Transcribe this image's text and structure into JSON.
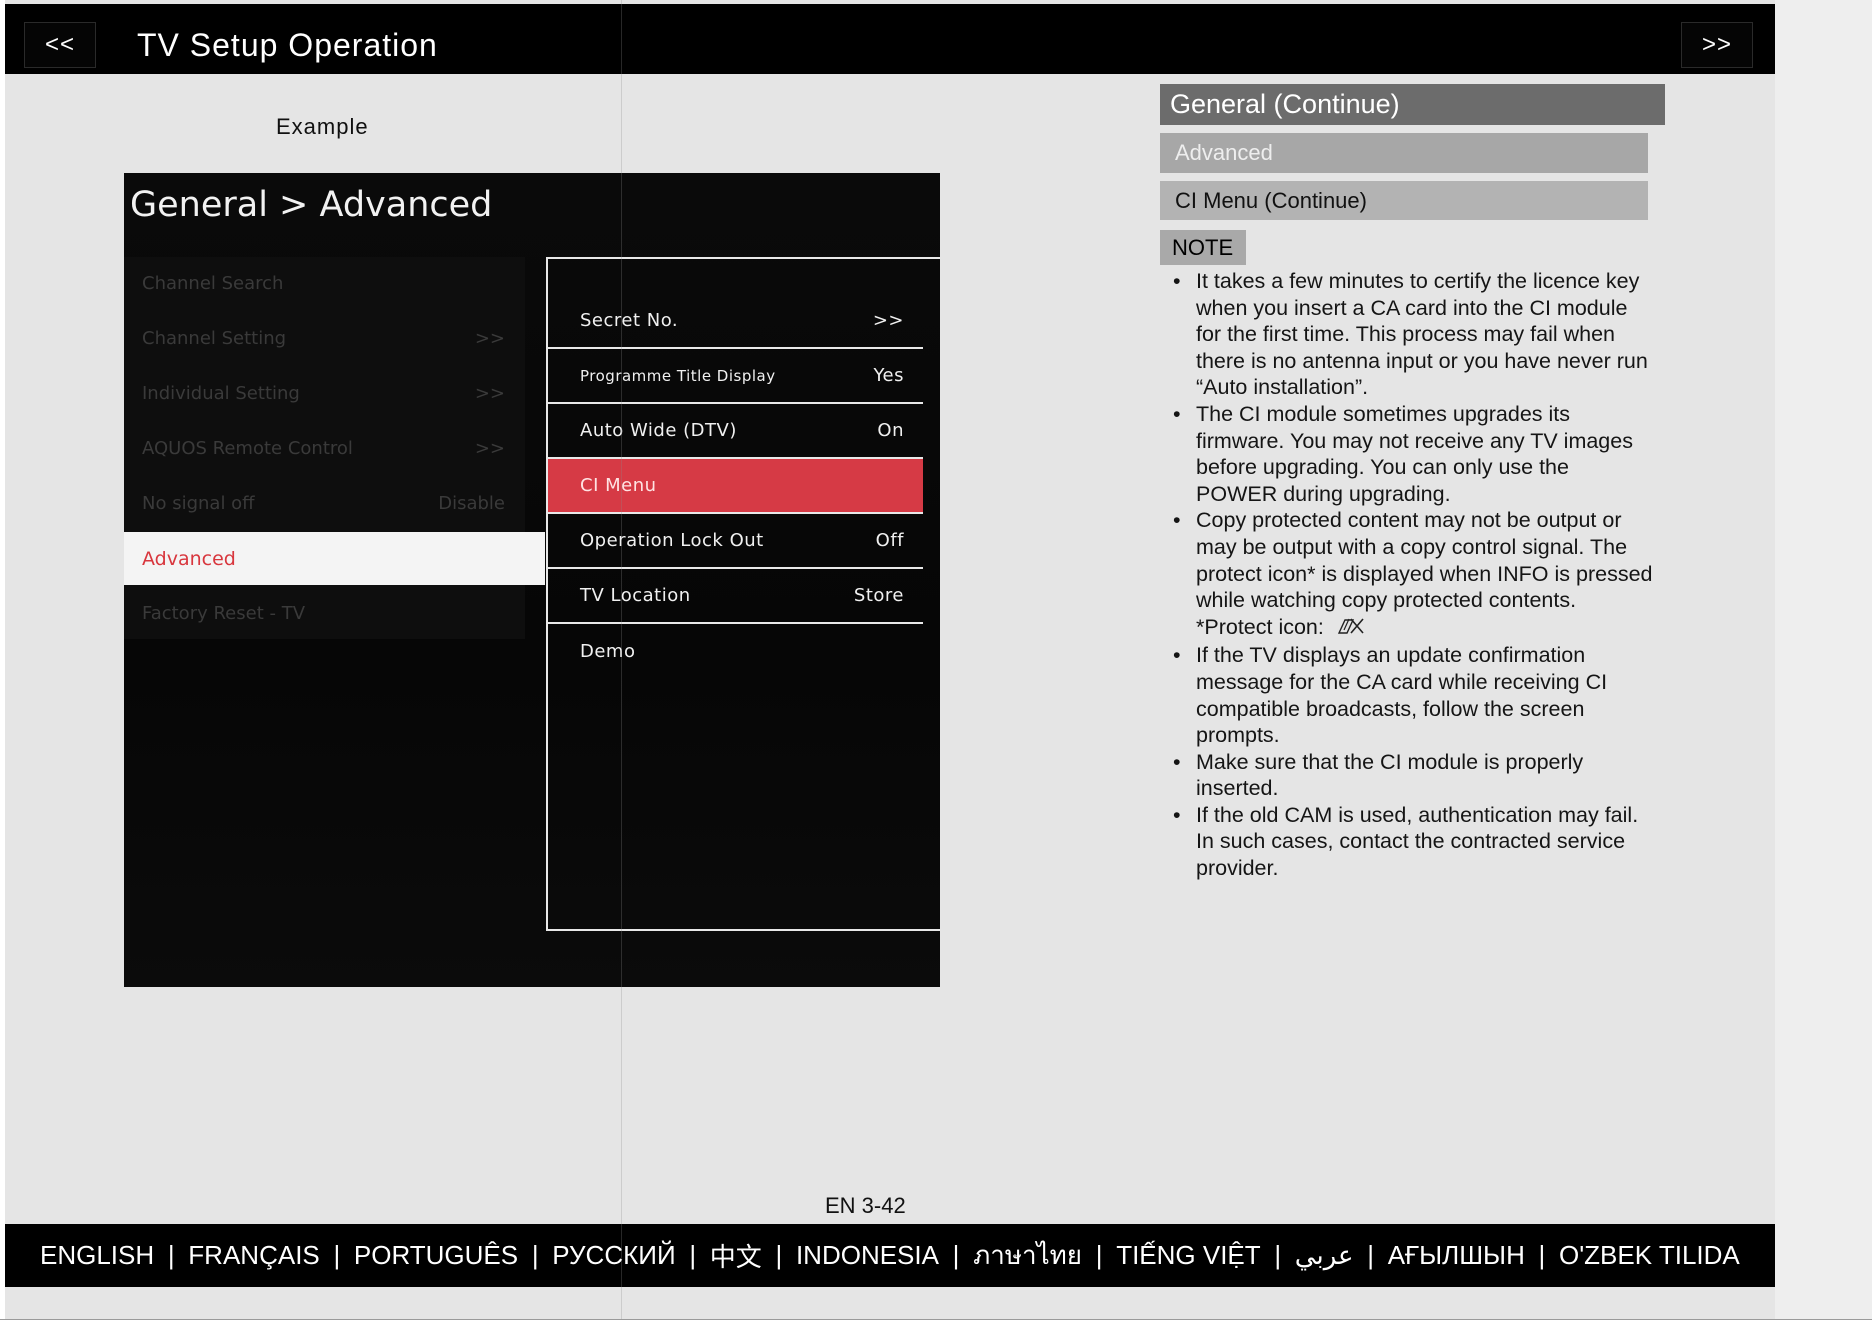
{
  "header": {
    "prev_label": "<<",
    "title": "TV Setup Operation",
    "next_label": ">>"
  },
  "example_label": "Example",
  "tv_screen": {
    "breadcrumb": "General > Advanced",
    "left_menu": [
      {
        "label": "Channel Search",
        "value": ""
      },
      {
        "label": "Channel Setting",
        "value": ">>"
      },
      {
        "label": "Individual Setting",
        "value": ">>"
      },
      {
        "label": "AQUOS Remote Control",
        "value": ">>"
      },
      {
        "label": "No signal off",
        "value": "Disable"
      },
      {
        "label": "Advanced",
        "value": "",
        "selected": true
      },
      {
        "label": "Factory Reset - TV",
        "value": ""
      }
    ],
    "right_menu": [
      {
        "label": "Secret No.",
        "value": ">>"
      },
      {
        "label": "Programme Title Display",
        "value": "Yes"
      },
      {
        "label": "Auto Wide (DTV)",
        "value": "On"
      },
      {
        "label": "CI Menu",
        "value": "",
        "selected": true
      },
      {
        "label": "Operation Lock Out",
        "value": "Off"
      },
      {
        "label": "TV Location",
        "value": "Store"
      },
      {
        "label": "Demo",
        "value": ""
      }
    ]
  },
  "sidebar": {
    "section_title": "General (Continue)",
    "subsection": "Advanced",
    "topic": "CI Menu (Continue)",
    "note_label": "NOTE",
    "bullet": "•",
    "notes": [
      "It takes a few minutes to certify the licence key when you insert a CA card into the CI module for the first time. This process may fail when there is no antenna input or you have never run “Auto installation”.",
      "The CI module sometimes upgrades its firmware. You may not receive any TV images before upgrading. You can only use the POWER during upgrading.",
      "Copy protected content may not be output or may be output with a copy control signal. The protect icon* is displayed when INFO is pressed while watching copy protected contents.",
      "If the TV displays an update confirmation message for the CA card while receiving CI compatible broadcasts, follow the screen prompts.",
      "Make sure that the CI module is properly inserted.",
      "If the old CAM is used, authentication may fail. In such cases, contact the contracted service provider."
    ],
    "protect_icon_label": "*Protect icon:",
    "protect_icon": "copy-protect-icon"
  },
  "page_number": "EN 3-42",
  "language_separator": "|",
  "languages": [
    "ENGLISH",
    "FRANÇAIS",
    "PORTUGUÊS",
    "РУССКИЙ",
    "中文",
    "INDONESIA",
    "ภาษาไทย",
    "TIẾNG VIỆT",
    "عربي",
    "АҒЫЛШЫН",
    "O'ZBEK TILIDA"
  ],
  "colors": {
    "header_bg": "#000000",
    "page_bg": "#e5e5e5",
    "highlight_red": "#d63a45",
    "selected_text_red": "#d8363d",
    "section_title_bg": "#6c6c6c",
    "subsection_bg": "#a7a7a7",
    "topic_bg": "#b3b3b3"
  }
}
